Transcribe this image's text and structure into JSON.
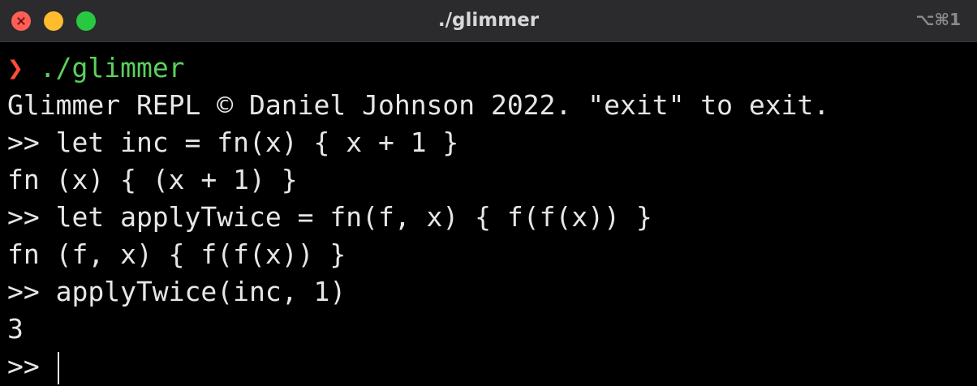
{
  "window": {
    "title": "./glimmer",
    "shortcut": "⌥⌘1"
  },
  "terminal": {
    "prompt": {
      "chevron": "❯",
      "command": " ./glimmer"
    },
    "lines": [
      "Glimmer REPL © Daniel Johnson 2022. \"exit\" to exit.",
      ">> let inc = fn(x) { x + 1 }",
      "fn (x) { (x + 1) }",
      ">> let applyTwice = fn(f, x) { f(f(x)) }",
      "fn (f, x) { f(f(x)) }",
      ">> applyTwice(inc, 1)",
      "3"
    ],
    "input_prompt": ">> "
  },
  "colors": {
    "background": "#000000",
    "titlebar": "#2b2b2e",
    "text": "#e6e6e6",
    "chevron": "#ff4d3a",
    "command": "#5bd15b",
    "close": "#ff5f57",
    "minimize": "#febc2e",
    "zoom": "#28c840"
  }
}
